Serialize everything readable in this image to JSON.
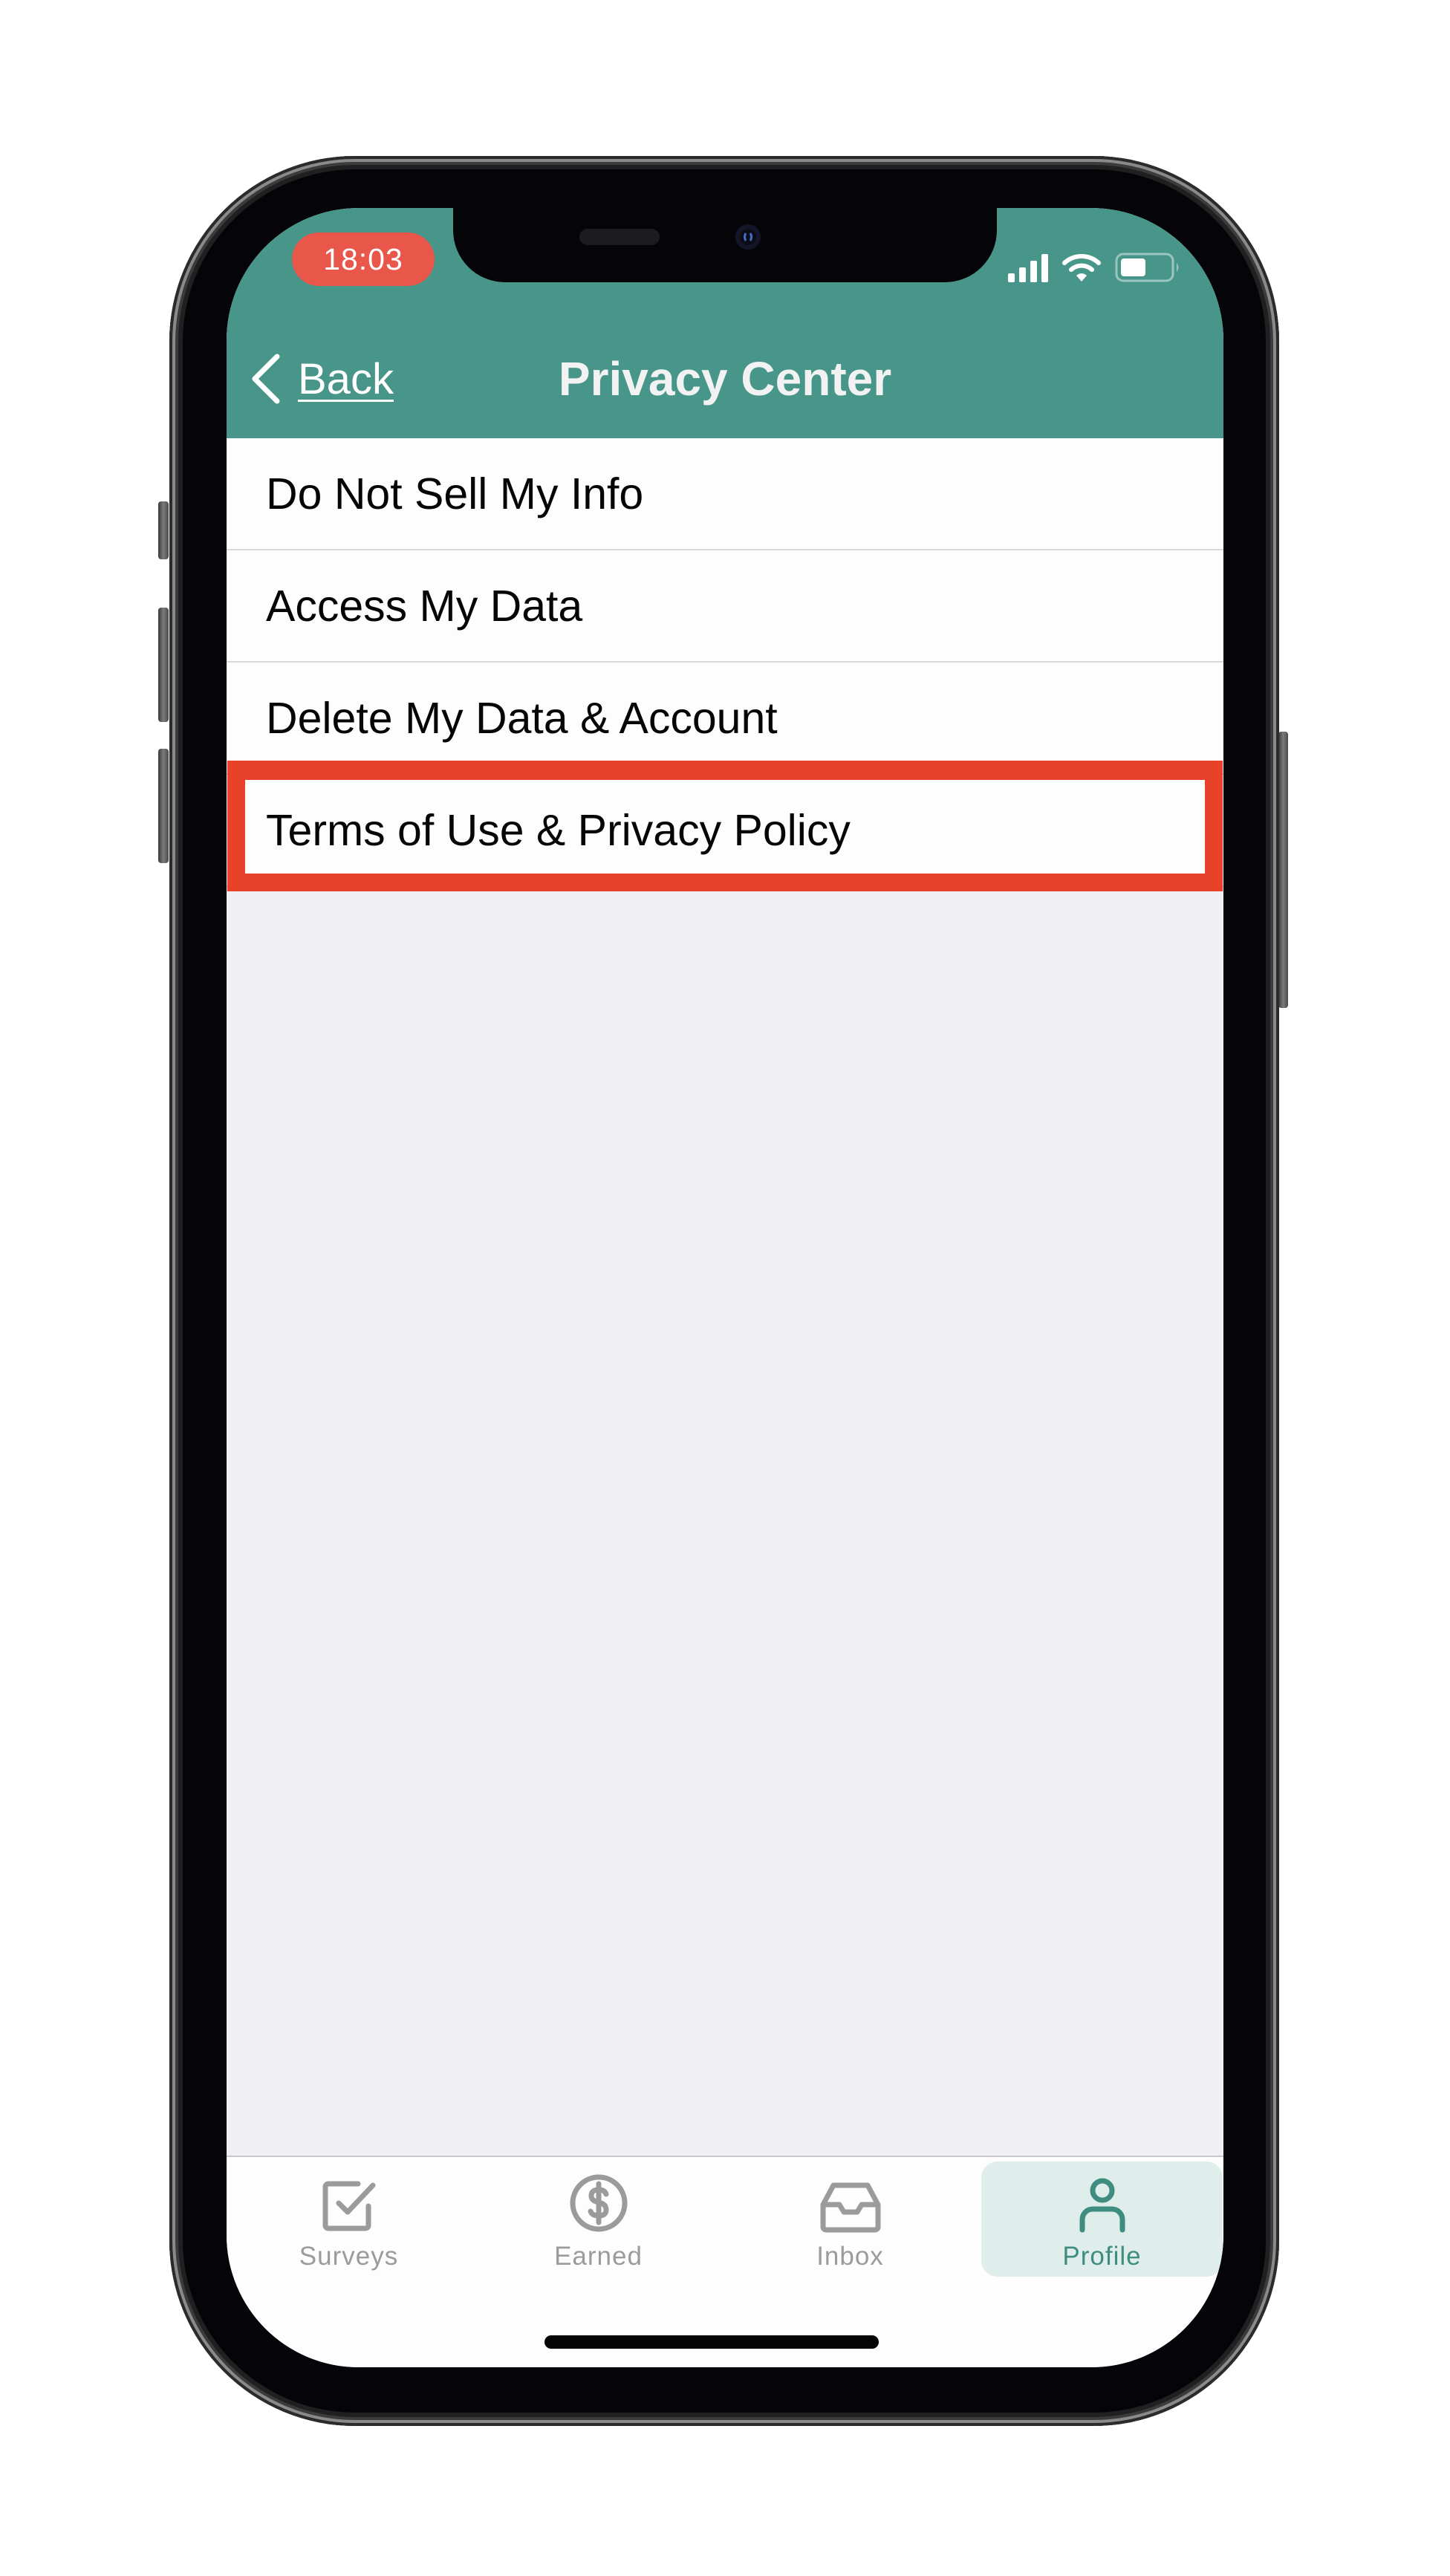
{
  "status_bar": {
    "time": "18:03",
    "signal_icon": "cellular-signal-icon",
    "wifi_icon": "wifi-icon",
    "battery_icon": "battery-icon",
    "battery_level_fraction": 0.5
  },
  "nav": {
    "back_label": "Back",
    "back_icon": "chevron-left-icon",
    "title": "Privacy Center"
  },
  "list": {
    "items": [
      {
        "label": "Do Not Sell My Info"
      },
      {
        "label": "Access My Data"
      },
      {
        "label": "Delete My Data & Account"
      },
      {
        "label": "Terms of Use & Privacy Policy",
        "highlighted": true
      }
    ]
  },
  "tab_bar": {
    "tabs": [
      {
        "label": "Surveys",
        "icon": "checkbox-icon",
        "active": false
      },
      {
        "label": "Earned",
        "icon": "dollar-circle-icon",
        "active": false
      },
      {
        "label": "Inbox",
        "icon": "inbox-tray-icon",
        "active": false
      },
      {
        "label": "Profile",
        "icon": "person-icon",
        "active": true
      }
    ]
  },
  "colors": {
    "header_teal": "#48958a",
    "time_pill": "#e8574a",
    "highlight_outline": "#e8432a",
    "active_tab_bg": "#dfeeeb",
    "active_tab_fg": "#3f8c80",
    "inactive_tab_fg": "#9b9b9b",
    "content_bg": "#f0f0f4"
  }
}
